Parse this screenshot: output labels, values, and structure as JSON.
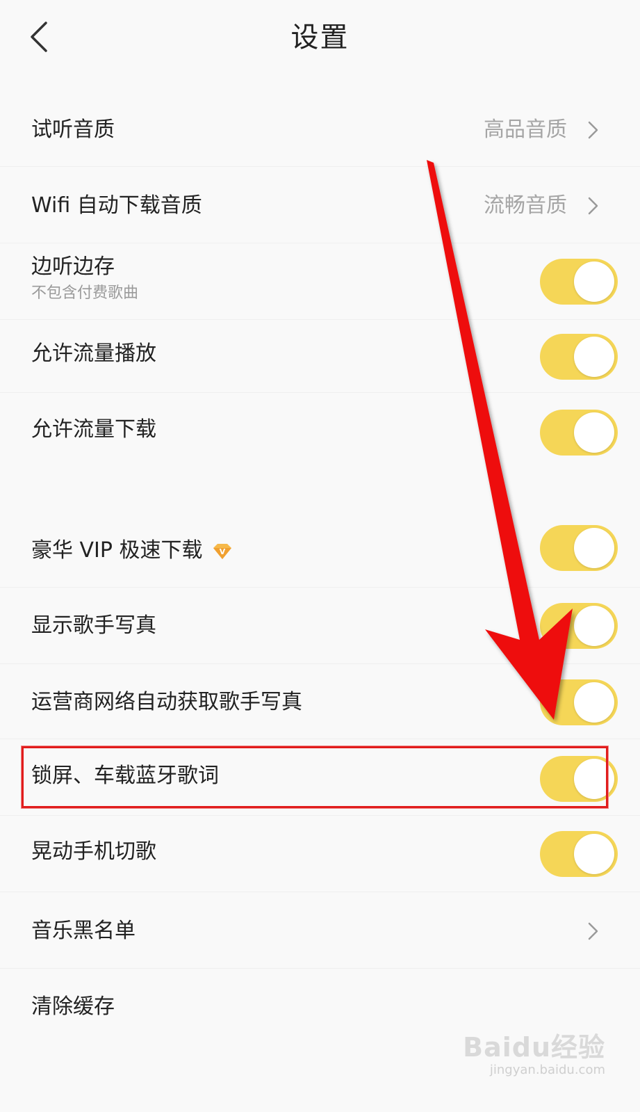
{
  "header": {
    "title": "设置",
    "back_icon": "chevron-left-icon"
  },
  "rows": [
    {
      "label": "试听音质",
      "value": "高品音质"
    },
    {
      "label": "Wifi 自动下载音质",
      "value": "流畅音质"
    },
    {
      "label": "边听边存",
      "sub": "不包含付费歌曲",
      "toggle": true
    },
    {
      "label": "允许流量播放",
      "toggle": true
    },
    {
      "label": "允许流量下载",
      "toggle": true
    },
    {
      "label": "豪华 VIP 极速下载",
      "toggle": true,
      "badge": "vip-diamond-icon"
    },
    {
      "label": "显示歌手写真",
      "toggle": true
    },
    {
      "label": "运营商网络自动获取歌手写真",
      "toggle": true
    },
    {
      "label": "锁屏、车载蓝牙歌词",
      "toggle": true,
      "highlighted": true
    },
    {
      "label": "晃动手机切歌",
      "toggle": true
    },
    {
      "label": "音乐黑名单"
    },
    {
      "label": "清除缓存"
    }
  ],
  "watermark": {
    "logo": "Baidu经验",
    "url": "jingyan.baidu.com"
  },
  "colors": {
    "toggle_on": "#f5d657",
    "annotation": "#e11d1d",
    "background": "#f9f9f9"
  }
}
